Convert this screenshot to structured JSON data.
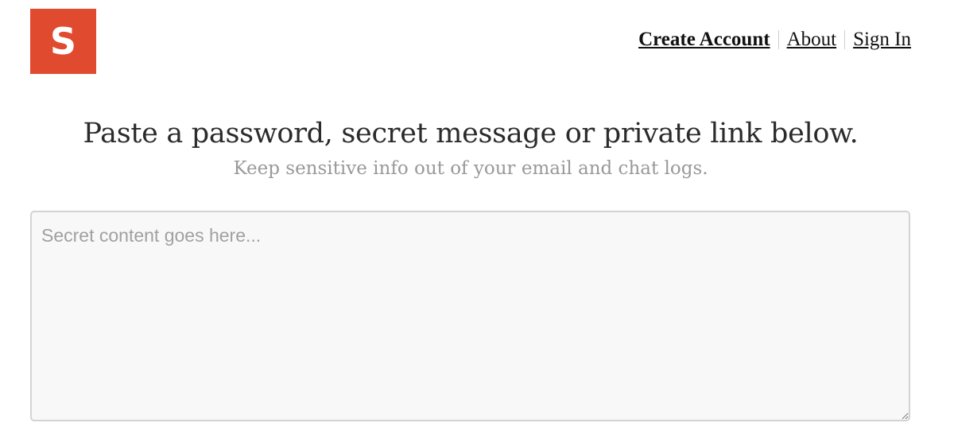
{
  "brand": {
    "logo_letter": "S",
    "logo_color": "#e04a2f"
  },
  "nav": {
    "items": [
      {
        "label": "Create Account",
        "emphasis": true
      },
      {
        "label": "About",
        "emphasis": false
      },
      {
        "label": "Sign In",
        "emphasis": false
      }
    ]
  },
  "main": {
    "headline": "Paste a password, secret message or private link below.",
    "subhead": "Keep sensitive info out of your email and chat logs.",
    "secret_input": {
      "placeholder": "Secret content goes here...",
      "value": ""
    }
  }
}
